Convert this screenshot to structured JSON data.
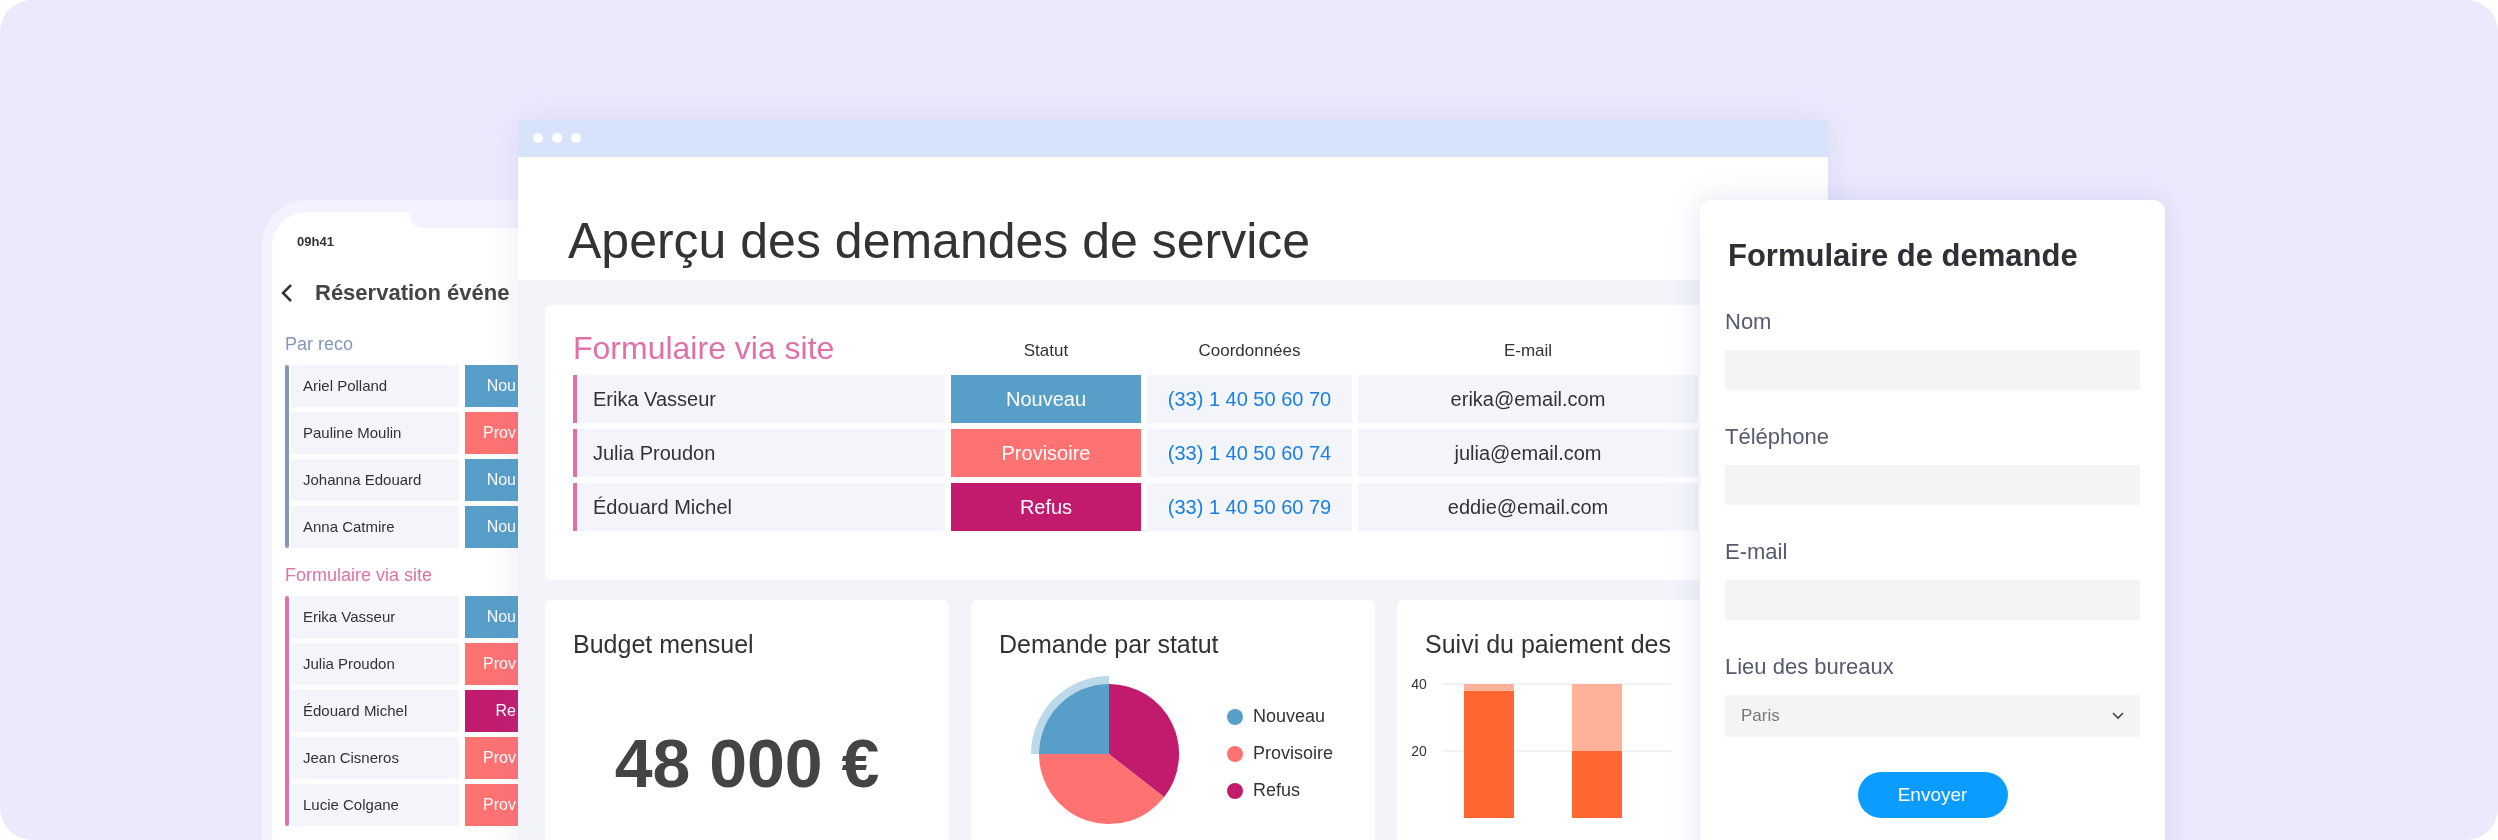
{
  "phone": {
    "time": "09h41",
    "title": "Réservation événe",
    "groups": [
      {
        "name": "Par reco",
        "color": "#8497bd",
        "rows": [
          {
            "name": "Ariel Polland",
            "status": "Nou",
            "color": "#579fc8"
          },
          {
            "name": "Pauline Moulin",
            "status": "Prov",
            "color": "#ff7272"
          },
          {
            "name": "Johanna Edouard",
            "status": "Nou",
            "color": "#579fc8"
          },
          {
            "name": "Anna Catmire",
            "status": "Nou",
            "color": "#579fc8"
          }
        ]
      },
      {
        "name": "Formulaire via site",
        "color": "#e070a8",
        "rows": [
          {
            "name": "Erika Vasseur",
            "status": "Nou",
            "color": "#579fc8"
          },
          {
            "name": "Julia Proudon",
            "status": "Prov",
            "color": "#ff7272"
          },
          {
            "name": "Édouard Michel",
            "status": "Re",
            "color": "#c21b6e"
          },
          {
            "name": "Jean Cisneros",
            "status": "Prov",
            "color": "#ff7272"
          },
          {
            "name": "Lucie Colgane",
            "status": "Prov",
            "color": "#ff7272"
          }
        ]
      }
    ]
  },
  "browser": {
    "title": "Aperçu des demandes de service",
    "table": {
      "group": {
        "title": "Formulaire via site",
        "color": "#e070a8"
      },
      "columns": [
        "Statut",
        "Coordonnées",
        "E-mail"
      ],
      "rows": [
        {
          "name": "Erika Vasseur",
          "status": "Nouveau",
          "color": "#579fc8",
          "phone": "(33) 1 40 50 60 70",
          "email": "erika@email.com"
        },
        {
          "name": "Julia Proudon",
          "status": "Provisoire",
          "color": "#ff7272",
          "phone": "(33) 1 40 50 60 74",
          "email": "julia@email.com"
        },
        {
          "name": "Édouard Michel",
          "status": "Refus",
          "color": "#c21b6e",
          "phone": "(33) 1 40 50 60 79",
          "email": "eddie@email.com"
        }
      ]
    },
    "budget": {
      "title": "Budget mensuel",
      "value": "48 000 €"
    },
    "status_chart": {
      "title": "Demande par statut",
      "legend": [
        {
          "label": "Nouveau",
          "color": "#579fc8"
        },
        {
          "label": "Provisoire",
          "color": "#ff7272"
        },
        {
          "label": "Refus",
          "color": "#c21b6e"
        }
      ]
    },
    "payments": {
      "title": "Suivi du paiement des",
      "chart_data": {
        "type": "bar",
        "stacked": true,
        "ylim": [
          0,
          40
        ],
        "yticks": [
          20,
          40
        ],
        "series": [
          {
            "color": "#ff6630",
            "values": [
              38,
              20
            ]
          },
          {
            "color": "#ffb199",
            "values": [
              2,
              20
            ]
          }
        ]
      }
    }
  },
  "form": {
    "title": "Formulaire de demande",
    "fields": [
      {
        "label": "Nom",
        "kind": "text"
      },
      {
        "label": "Téléphone",
        "kind": "text"
      },
      {
        "label": "E-mail",
        "kind": "text"
      },
      {
        "label": "Lieu des bureaux",
        "kind": "select",
        "value": "Paris"
      }
    ],
    "button": "Envoyer"
  }
}
